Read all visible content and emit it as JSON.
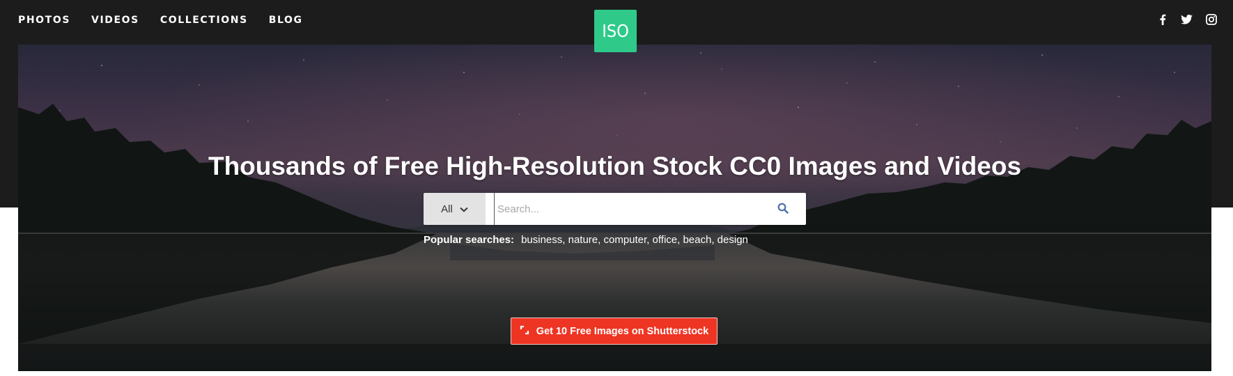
{
  "nav": {
    "items": [
      {
        "label": "PHOTOS"
      },
      {
        "label": "VIDEOS"
      },
      {
        "label": "COLLECTIONS"
      },
      {
        "label": "BLOG"
      }
    ]
  },
  "logo": {
    "text": "ISO",
    "color": "#2fca8a"
  },
  "social": {
    "icons": [
      "facebook-icon",
      "twitter-icon",
      "instagram-icon"
    ]
  },
  "hero": {
    "headline": "Thousands of Free High-Resolution Stock CC0 Images and Videos"
  },
  "search": {
    "category": "All",
    "placeholder": "Search...",
    "value": ""
  },
  "popular": {
    "label": "Popular searches:",
    "terms": [
      "business,",
      "nature,",
      "computer,",
      "office,",
      "beach,",
      "design"
    ]
  },
  "cta": {
    "label": "Get 10 Free Images on Shutterstock",
    "color": "#ee3524"
  }
}
